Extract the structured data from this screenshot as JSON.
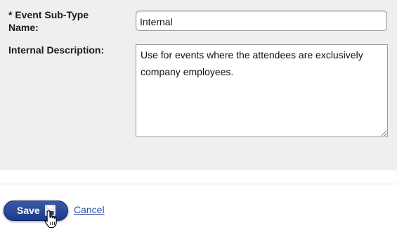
{
  "form": {
    "subtype_label": "* Event Sub-Type Name:",
    "subtype_value": "Internal",
    "description_label": "Internal Description:",
    "description_value": "Use for events where the attendees are exclusively company employees."
  },
  "actions": {
    "save_label": "Save",
    "save_icon": "floppy-disk-icon",
    "cancel_label": "Cancel"
  },
  "cursor": "hand-pointer-icon",
  "colors": {
    "panel_background": "#efefef",
    "save_button": "#1c3a8a",
    "link": "#2a4fa3"
  }
}
